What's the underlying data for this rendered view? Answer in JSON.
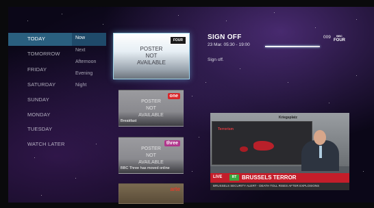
{
  "days": [
    {
      "label": "TODAY",
      "active": true
    },
    {
      "label": "TOMORROW",
      "active": false
    },
    {
      "label": "FRIDAY",
      "active": false
    },
    {
      "label": "SATURDAY",
      "active": false
    },
    {
      "label": "SUNDAY",
      "active": false
    },
    {
      "label": "MONDAY",
      "active": false
    },
    {
      "label": "TUESDAY",
      "active": false
    },
    {
      "label": "WATCH LATER",
      "active": false
    }
  ],
  "slots": [
    {
      "label": "Now",
      "active": true
    },
    {
      "label": "Next",
      "active": false
    },
    {
      "label": "Afternoon",
      "active": false
    },
    {
      "label": "Evening",
      "active": false
    },
    {
      "label": "Night",
      "active": false
    }
  ],
  "posters": {
    "placeholder": [
      "POSTER",
      "NOT",
      "AVAILABLE"
    ],
    "main": {
      "logo": "FOUR"
    },
    "p2": {
      "logo": "one",
      "caption": "Breakfast"
    },
    "p3": {
      "logo": "three",
      "caption": "BBC Three has moved online"
    },
    "p4": {
      "logo": "arte"
    }
  },
  "info": {
    "title": "SIGN OFF",
    "time": "23 Mar. 05:30 - 19:00",
    "description": "Sign off.",
    "channel_number": "009",
    "channel_logo_small": "BBC",
    "channel_logo": "FOUR"
  },
  "preview": {
    "live_label": "LIVE",
    "channel_badge": "RT",
    "headline": "BRUSSELS TERROR",
    "studio_text_1": "Terrorism",
    "studio_text_2": "Kriegsplatz",
    "subticker": "BRUSSELS SECURITY ALERT - DEATH TOLL RISES AFTER EXPLOSIONS"
  }
}
